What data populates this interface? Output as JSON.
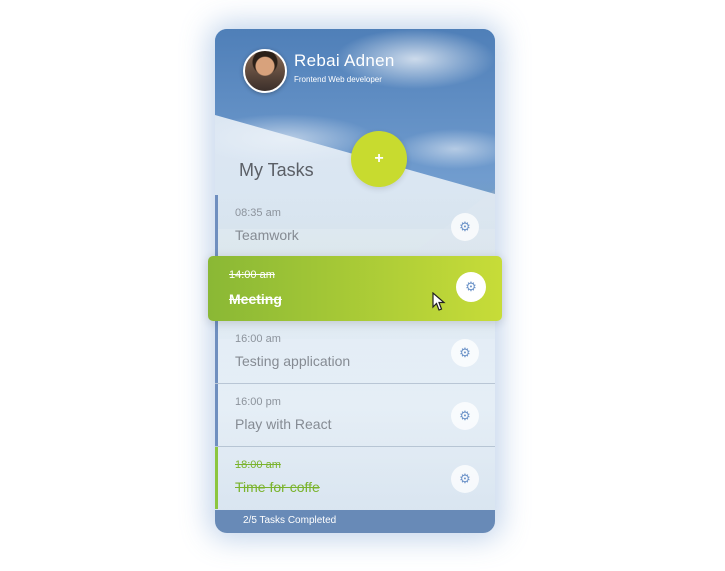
{
  "profile": {
    "name": "Rebai Adnen",
    "role": "Frontend Web developer"
  },
  "section_title": "My Tasks",
  "add_label": "+",
  "icons": {
    "gear": "gear-icon"
  },
  "tasks": [
    {
      "time": "08:35 am",
      "title": "Teamwork",
      "done": false
    },
    {
      "time": "14:00 am",
      "title": "Meeting",
      "done": true,
      "active": true
    },
    {
      "time": "16:00 am",
      "title": "Testing application",
      "done": false
    },
    {
      "time": "16:00 pm",
      "title": "Play with React",
      "done": false
    },
    {
      "time": "18:00 am",
      "title": "Time for coffe",
      "done": true
    }
  ],
  "footer": {
    "status": "2/5 Tasks Completed"
  },
  "colors": {
    "accent": "#c8db2f",
    "active_from": "#8ab835",
    "active_to": "#c7dc38",
    "done": "#7ab32c",
    "footer": "#6285b3"
  }
}
